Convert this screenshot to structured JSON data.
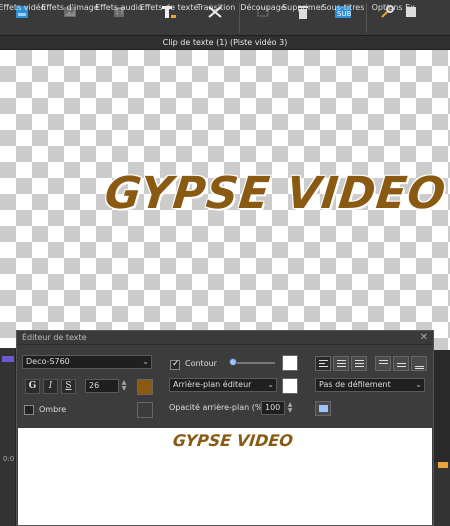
{
  "toolbar": {
    "items": [
      {
        "label": "Effets vidéo",
        "icon": "video-effects-icon",
        "enabled": true
      },
      {
        "label": "Effets d'image",
        "icon": "image-effects-icon",
        "enabled": false
      },
      {
        "label": "Effets audio",
        "icon": "audio-effects-icon",
        "enabled": false
      },
      {
        "label": "Effets de texte",
        "icon": "text-effects-icon",
        "enabled": true
      },
      {
        "label": "Transition",
        "icon": "transition-icon",
        "enabled": true
      },
      {
        "label": "Découpage",
        "icon": "split-icon",
        "enabled": false
      },
      {
        "label": "Supprimer",
        "icon": "trash-icon",
        "enabled": true
      },
      {
        "label": "Sous-titres",
        "icon": "subtitles-icon",
        "enabled": true
      },
      {
        "label": "Options",
        "icon": "tools-icon",
        "enabled": true
      },
      {
        "label": "Ex",
        "icon": "export-icon",
        "enabled": true
      }
    ]
  },
  "window": {
    "title": "Clip de texte (1) (Piste vidéo 3)"
  },
  "canvas": {
    "text": "GYPSE VIDEO",
    "text_color": "#8a5a12"
  },
  "dialog": {
    "title": "Éditeur de texte",
    "font": "Deco-S760",
    "bold_label": "G",
    "italic_label": "I",
    "strike_label": "S",
    "font_size": "26",
    "ombre_label": "Ombre",
    "contour_label": "Contour",
    "background_select": "Arrière-plan éditeur",
    "opacity_label": "Opacité arrière-plan (%):",
    "opacity_value": "100",
    "scroll_select": "Pas de défilement",
    "text_color": "#8a5a12",
    "preview_text": "GYPSE VIDEO"
  },
  "timeline": {
    "time": "0:0"
  }
}
